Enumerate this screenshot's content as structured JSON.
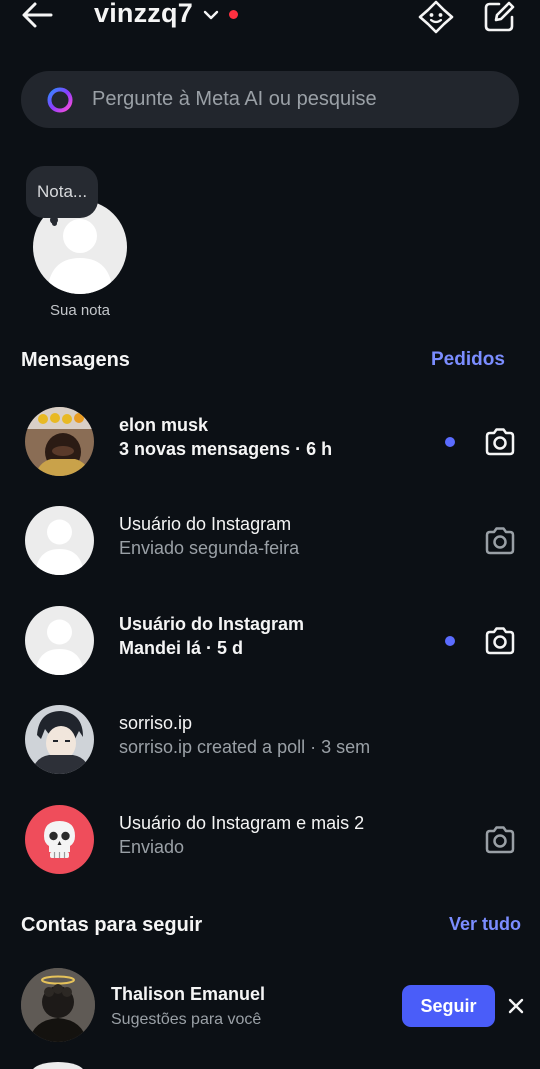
{
  "header": {
    "username": "vinzzq7",
    "notification_color": "#ff3040",
    "icons": [
      "back-arrow-icon",
      "chevron-down-icon",
      "meta-ai-icon",
      "compose-icon"
    ]
  },
  "search": {
    "placeholder": "Pergunte à Meta AI ou pesquise",
    "value": "",
    "icon": "meta-ai-ring-icon"
  },
  "note": {
    "bubble_text": "Nota...",
    "label": "Sua nota"
  },
  "messages": {
    "title": "Mensagens",
    "requests_link": "Pedidos",
    "threads": [
      {
        "name": "elon musk",
        "preview": "3 novas mensagens · 6 h",
        "unread": true,
        "camera": true,
        "avatar": "emoji-face-photo"
      },
      {
        "name": "Usuário do Instagram",
        "preview": "Enviado segunda-feira",
        "unread": false,
        "camera": true,
        "avatar": "default-avatar"
      },
      {
        "name": "Usuário do Instagram",
        "preview": "Mandei lá · 5 d",
        "unread": true,
        "camera": true,
        "avatar": "default-avatar"
      },
      {
        "name": "sorriso.ip",
        "preview": "sorriso.ip created a poll · 3 sem",
        "unread": false,
        "camera": false,
        "avatar": "anime-photo"
      },
      {
        "name": "Usuário do Instagram e mais 2",
        "preview": "Enviado",
        "unread": false,
        "camera": true,
        "avatar": "skull-emoji-group"
      }
    ]
  },
  "suggestions": {
    "title": "Contas para seguir",
    "see_all": "Ver tudo",
    "items": [
      {
        "name": "Thalison Emanuel",
        "subtitle": "Sugestões para você",
        "follow_label": "Seguir"
      }
    ]
  },
  "colors": {
    "background": "#0c1015",
    "accent": "#7b8dff",
    "unread_dot": "#5b6cff",
    "follow_button": "#4a5df9"
  }
}
